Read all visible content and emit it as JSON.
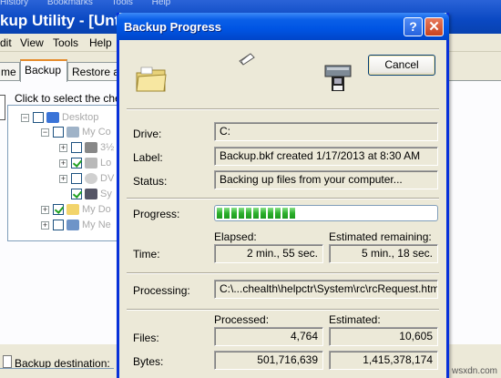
{
  "background_window": {
    "top_menu": [
      "History",
      "Bookmarks",
      "Tools",
      "Help"
    ],
    "title": "kup Utility - [Untitle",
    "menu": [
      "dit",
      "View",
      "Tools",
      "Help"
    ],
    "tabs": [
      "me",
      "Backup",
      "Restore a"
    ],
    "hint": "Click to select the chec",
    "tree": {
      "items": [
        {
          "label": "Desktop",
          "checked": false,
          "expander": "minus"
        },
        {
          "label": "My Co",
          "checked": false,
          "expander": "minus"
        },
        {
          "label": "3½",
          "checked": false,
          "expander": "plus"
        },
        {
          "label": "Lo",
          "checked": true,
          "expander": "plus"
        },
        {
          "label": "DV",
          "checked": false,
          "expander": "plus"
        },
        {
          "label": "Sy",
          "checked": true,
          "expander": "none"
        },
        {
          "label": "My Do",
          "checked": true,
          "expander": "plus"
        },
        {
          "label": "My Ne",
          "checked": false,
          "expander": "plus"
        }
      ]
    },
    "backup_destination_label": "Backup destination:"
  },
  "dialog": {
    "title": "Backup Progress",
    "cancel_label": "Cancel",
    "drive_label": "Drive:",
    "drive_value": "C:",
    "label_label": "Label:",
    "label_value": "Backup.bkf created 1/17/2013 at 8:30 AM",
    "status_label": "Status:",
    "status_value": "Backing up files from your computer...",
    "progress_label": "Progress:",
    "progress_fraction": 0.36,
    "time_label": "Time:",
    "elapsed_header": "Elapsed:",
    "elapsed_value": "2 min., 55 sec.",
    "remaining_header": "Estimated remaining:",
    "remaining_value": "5 min., 18 sec.",
    "processing_label": "Processing:",
    "processing_value": "C:\\...chealth\\helpctr\\System\\rc\\rcRequest.htm",
    "processed_header": "Processed:",
    "estimated_header": "Estimated:",
    "files_label": "Files:",
    "files_processed": "4,764",
    "files_estimated": "10,605",
    "bytes_label": "Bytes:",
    "bytes_processed": "501,716,639",
    "bytes_estimated": "1,415,378,174"
  },
  "watermark": "wsxdn.com",
  "colors": {
    "titlebar": "#0054e3",
    "progress_fill": "#2cb02c",
    "close_button": "#c7431f"
  }
}
